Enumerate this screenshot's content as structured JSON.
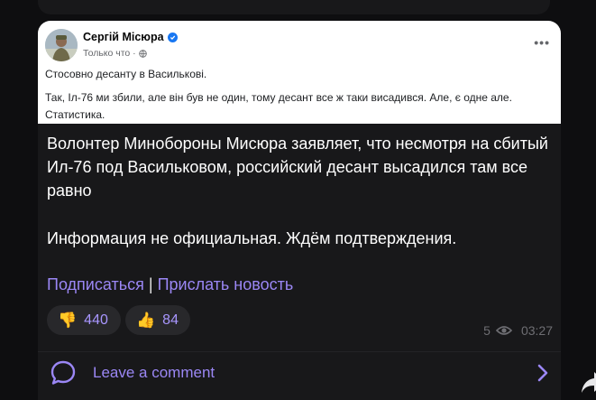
{
  "fb_post": {
    "author": "Сергій Місюра",
    "time": "Только что ·",
    "line1": "Стосовно десанту в Василькові.",
    "line2": "Так, Іл-76 ми збили, але він був не один, тому десант все ж таки висадився. Але, є одне але. Статистика."
  },
  "message": {
    "title": "Волонтер Минобороны Мисюра заявляет, что несмотря на сбитый Ил-76 под Васильковом, российский десант высадился там все равно",
    "note": "Информация не официальная. Ждём подтверждения.",
    "link_subscribe": "Подписаться",
    "separator": "|",
    "link_send": "Прислать новость"
  },
  "reactions": [
    {
      "emoji": "👎",
      "count": "440"
    },
    {
      "emoji": "👍",
      "count": "84"
    }
  ],
  "stats": {
    "views": "5",
    "time": "03:27"
  },
  "comment": {
    "label": "Leave a comment"
  },
  "icons": {
    "verified": "verified-badge-icon",
    "globe": "globe-icon",
    "more": "more-options-icon",
    "views": "eye-icon",
    "comment": "comment-bubble-icon",
    "chevron": "chevron-right-icon",
    "share": "share-arrow-icon"
  },
  "colors": {
    "accent": "#9b87f5",
    "background": "#0e0e10",
    "card": "#18181a",
    "fb_blue": "#1877f2"
  }
}
